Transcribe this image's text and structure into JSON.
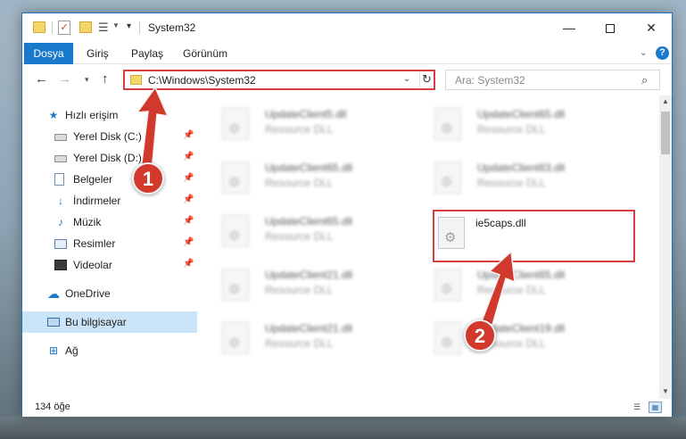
{
  "window": {
    "title": "System32",
    "minimize_glyph": "—",
    "close_glyph": "✕"
  },
  "ribbon": {
    "tabs": [
      {
        "label": "Dosya",
        "active": true
      },
      {
        "label": "Giriş"
      },
      {
        "label": "Paylaş"
      },
      {
        "label": "Görünüm"
      }
    ]
  },
  "address_bar": {
    "path": "C:\\Windows\\System32"
  },
  "search": {
    "placeholder": "Ara: System32"
  },
  "sidebar": {
    "items": [
      {
        "label": "Hızlı erişim",
        "icon": "star-icon",
        "pinned": false
      },
      {
        "label": "Yerel Disk (C:)",
        "icon": "drive-icon",
        "pinned": true
      },
      {
        "label": "Yerel Disk (D:)",
        "icon": "drive-icon",
        "pinned": true
      },
      {
        "label": "Belgeler",
        "icon": "document-icon",
        "pinned": true
      },
      {
        "label": "İndirmeler",
        "icon": "download-icon",
        "pinned": true
      },
      {
        "label": "Müzik",
        "icon": "music-icon",
        "pinned": true
      },
      {
        "label": "Resimler",
        "icon": "pictures-icon",
        "pinned": true
      },
      {
        "label": "Videolar",
        "icon": "video-icon",
        "pinned": true
      },
      {
        "label": "OneDrive",
        "icon": "cloud-icon",
        "pinned": false
      },
      {
        "label": "Bu bilgisayar",
        "icon": "computer-icon",
        "pinned": false,
        "selected": true
      },
      {
        "label": "Ağ",
        "icon": "network-icon",
        "pinned": false
      }
    ]
  },
  "files": [
    {
      "name": "UpdateClient5.dll",
      "type": "Resource DLL",
      "blurred": true
    },
    {
      "name": "UpdateClient65.dll",
      "type": "Resource DLL",
      "blurred": true
    },
    {
      "name": "UpdateClient65.dll",
      "type": "Resource DLL",
      "blurred": true
    },
    {
      "name": "UpdateClient63.dll",
      "type": "Resource DLL",
      "blurred": true
    },
    {
      "name": "UpdateClient65.dll",
      "type": "Resource DLL",
      "blurred": true
    },
    {
      "name": "ie5caps.dll",
      "type": "",
      "blurred": false,
      "highlighted": true
    },
    {
      "name": "UpdateClient21.dll",
      "type": "Resource DLL",
      "blurred": true
    },
    {
      "name": "UpdateClient65.dll",
      "type": "Resource DLL",
      "blurred": true
    },
    {
      "name": "UpdateClient21.dll",
      "type": "Resource DLL",
      "blurred": true
    },
    {
      "name": "UpdateClient19.dll",
      "type": "Resource DLL",
      "blurred": true
    }
  ],
  "status_bar": {
    "item_count": "134 öğe"
  },
  "callouts": [
    {
      "number": "1"
    },
    {
      "number": "2"
    }
  ],
  "colors": {
    "accent": "#1979ca",
    "annotation_red": "#d0392b",
    "selection": "#cce4f7"
  }
}
